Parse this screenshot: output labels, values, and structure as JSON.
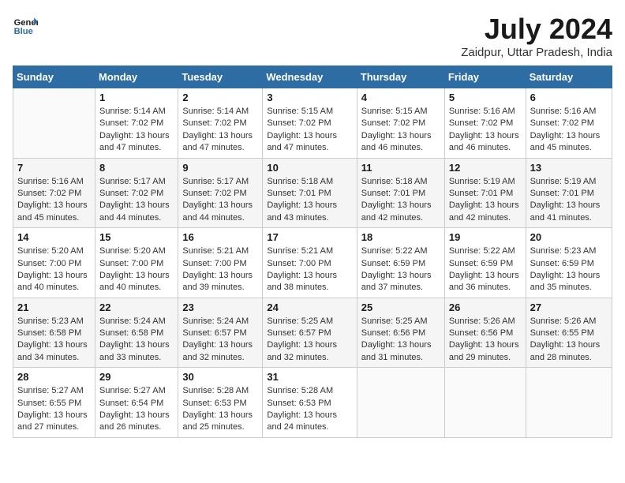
{
  "header": {
    "logo_line1": "General",
    "logo_line2": "Blue",
    "month_year": "July 2024",
    "location": "Zaidpur, Uttar Pradesh, India"
  },
  "columns": [
    "Sunday",
    "Monday",
    "Tuesday",
    "Wednesday",
    "Thursday",
    "Friday",
    "Saturday"
  ],
  "weeks": [
    [
      {
        "day": "",
        "sunrise": "",
        "sunset": "",
        "daylight": ""
      },
      {
        "day": "1",
        "sunrise": "5:14 AM",
        "sunset": "7:02 PM",
        "daylight": "13 hours and 47 minutes."
      },
      {
        "day": "2",
        "sunrise": "5:14 AM",
        "sunset": "7:02 PM",
        "daylight": "13 hours and 47 minutes."
      },
      {
        "day": "3",
        "sunrise": "5:15 AM",
        "sunset": "7:02 PM",
        "daylight": "13 hours and 47 minutes."
      },
      {
        "day": "4",
        "sunrise": "5:15 AM",
        "sunset": "7:02 PM",
        "daylight": "13 hours and 46 minutes."
      },
      {
        "day": "5",
        "sunrise": "5:16 AM",
        "sunset": "7:02 PM",
        "daylight": "13 hours and 46 minutes."
      },
      {
        "day": "6",
        "sunrise": "5:16 AM",
        "sunset": "7:02 PM",
        "daylight": "13 hours and 45 minutes."
      }
    ],
    [
      {
        "day": "7",
        "sunrise": "5:16 AM",
        "sunset": "7:02 PM",
        "daylight": "13 hours and 45 minutes."
      },
      {
        "day": "8",
        "sunrise": "5:17 AM",
        "sunset": "7:02 PM",
        "daylight": "13 hours and 44 minutes."
      },
      {
        "day": "9",
        "sunrise": "5:17 AM",
        "sunset": "7:02 PM",
        "daylight": "13 hours and 44 minutes."
      },
      {
        "day": "10",
        "sunrise": "5:18 AM",
        "sunset": "7:01 PM",
        "daylight": "13 hours and 43 minutes."
      },
      {
        "day": "11",
        "sunrise": "5:18 AM",
        "sunset": "7:01 PM",
        "daylight": "13 hours and 42 minutes."
      },
      {
        "day": "12",
        "sunrise": "5:19 AM",
        "sunset": "7:01 PM",
        "daylight": "13 hours and 42 minutes."
      },
      {
        "day": "13",
        "sunrise": "5:19 AM",
        "sunset": "7:01 PM",
        "daylight": "13 hours and 41 minutes."
      }
    ],
    [
      {
        "day": "14",
        "sunrise": "5:20 AM",
        "sunset": "7:00 PM",
        "daylight": "13 hours and 40 minutes."
      },
      {
        "day": "15",
        "sunrise": "5:20 AM",
        "sunset": "7:00 PM",
        "daylight": "13 hours and 40 minutes."
      },
      {
        "day": "16",
        "sunrise": "5:21 AM",
        "sunset": "7:00 PM",
        "daylight": "13 hours and 39 minutes."
      },
      {
        "day": "17",
        "sunrise": "5:21 AM",
        "sunset": "7:00 PM",
        "daylight": "13 hours and 38 minutes."
      },
      {
        "day": "18",
        "sunrise": "5:22 AM",
        "sunset": "6:59 PM",
        "daylight": "13 hours and 37 minutes."
      },
      {
        "day": "19",
        "sunrise": "5:22 AM",
        "sunset": "6:59 PM",
        "daylight": "13 hours and 36 minutes."
      },
      {
        "day": "20",
        "sunrise": "5:23 AM",
        "sunset": "6:59 PM",
        "daylight": "13 hours and 35 minutes."
      }
    ],
    [
      {
        "day": "21",
        "sunrise": "5:23 AM",
        "sunset": "6:58 PM",
        "daylight": "13 hours and 34 minutes."
      },
      {
        "day": "22",
        "sunrise": "5:24 AM",
        "sunset": "6:58 PM",
        "daylight": "13 hours and 33 minutes."
      },
      {
        "day": "23",
        "sunrise": "5:24 AM",
        "sunset": "6:57 PM",
        "daylight": "13 hours and 32 minutes."
      },
      {
        "day": "24",
        "sunrise": "5:25 AM",
        "sunset": "6:57 PM",
        "daylight": "13 hours and 32 minutes."
      },
      {
        "day": "25",
        "sunrise": "5:25 AM",
        "sunset": "6:56 PM",
        "daylight": "13 hours and 31 minutes."
      },
      {
        "day": "26",
        "sunrise": "5:26 AM",
        "sunset": "6:56 PM",
        "daylight": "13 hours and 29 minutes."
      },
      {
        "day": "27",
        "sunrise": "5:26 AM",
        "sunset": "6:55 PM",
        "daylight": "13 hours and 28 minutes."
      }
    ],
    [
      {
        "day": "28",
        "sunrise": "5:27 AM",
        "sunset": "6:55 PM",
        "daylight": "13 hours and 27 minutes."
      },
      {
        "day": "29",
        "sunrise": "5:27 AM",
        "sunset": "6:54 PM",
        "daylight": "13 hours and 26 minutes."
      },
      {
        "day": "30",
        "sunrise": "5:28 AM",
        "sunset": "6:53 PM",
        "daylight": "13 hours and 25 minutes."
      },
      {
        "day": "31",
        "sunrise": "5:28 AM",
        "sunset": "6:53 PM",
        "daylight": "13 hours and 24 minutes."
      },
      {
        "day": "",
        "sunrise": "",
        "sunset": "",
        "daylight": ""
      },
      {
        "day": "",
        "sunrise": "",
        "sunset": "",
        "daylight": ""
      },
      {
        "day": "",
        "sunrise": "",
        "sunset": "",
        "daylight": ""
      }
    ]
  ]
}
